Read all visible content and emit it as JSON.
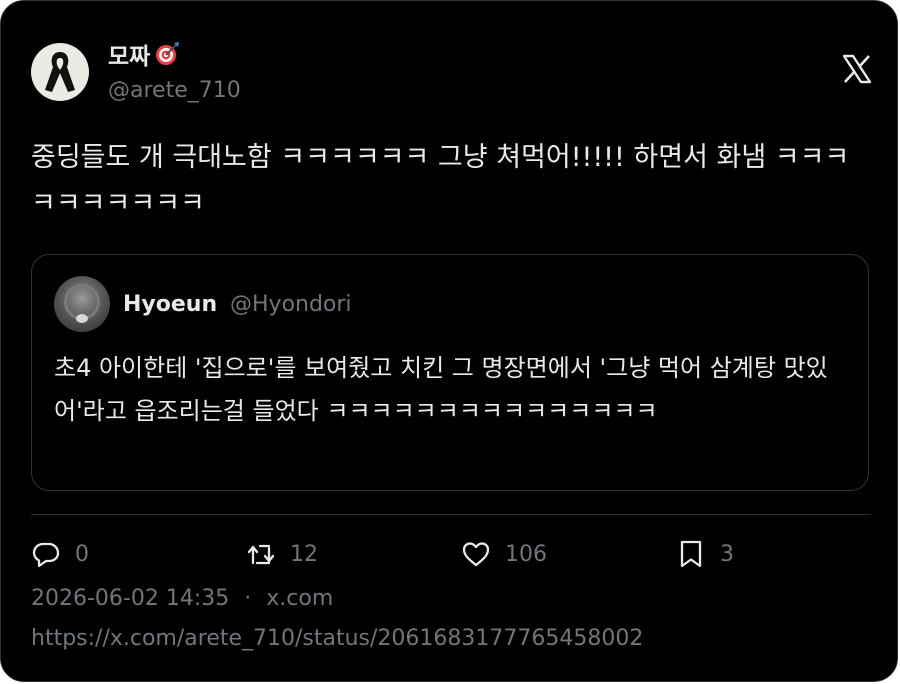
{
  "author": {
    "display_name": "모짜",
    "name_emoji_icon": "direct-hit-target-icon",
    "handle": "@arete_710",
    "avatar_icon": "black-ribbon-icon"
  },
  "brand_icon": "x-logo-icon",
  "tweet": {
    "text": "중딩들도 개 극대노함 ㅋㅋㅋㅋㅋㅋ 그냥 쳐먹어!!!!! 하면서 화냄 ㅋㅋㅋㅋㅋㅋㅋㅋㅋㅋ"
  },
  "quoted": {
    "display_name": "Hyoeun",
    "handle": "@Hyondori",
    "text": "초4 아이한테 '집으로'를 보여줬고 치킨 그 명장면에서 '그냥 먹어 삼계탕 맛있어'라고 읍조리는걸 들었다 ㅋㅋㅋㅋㅋㅋㅋㅋㅋㅋㅋㅋㅋㅋㅋ"
  },
  "actions": {
    "replies": "0",
    "reposts": "12",
    "likes": "106",
    "bookmarks": "3"
  },
  "meta": {
    "timestamp": "2026-06-02 14:35",
    "separator": "·",
    "source": "x.com"
  },
  "url": "https://x.com/arete_710/status/2061683177765458002",
  "colors": {
    "background": "#000000",
    "text_primary": "#e7e9ea",
    "text_secondary": "#71767b",
    "border": "#2f3336"
  }
}
